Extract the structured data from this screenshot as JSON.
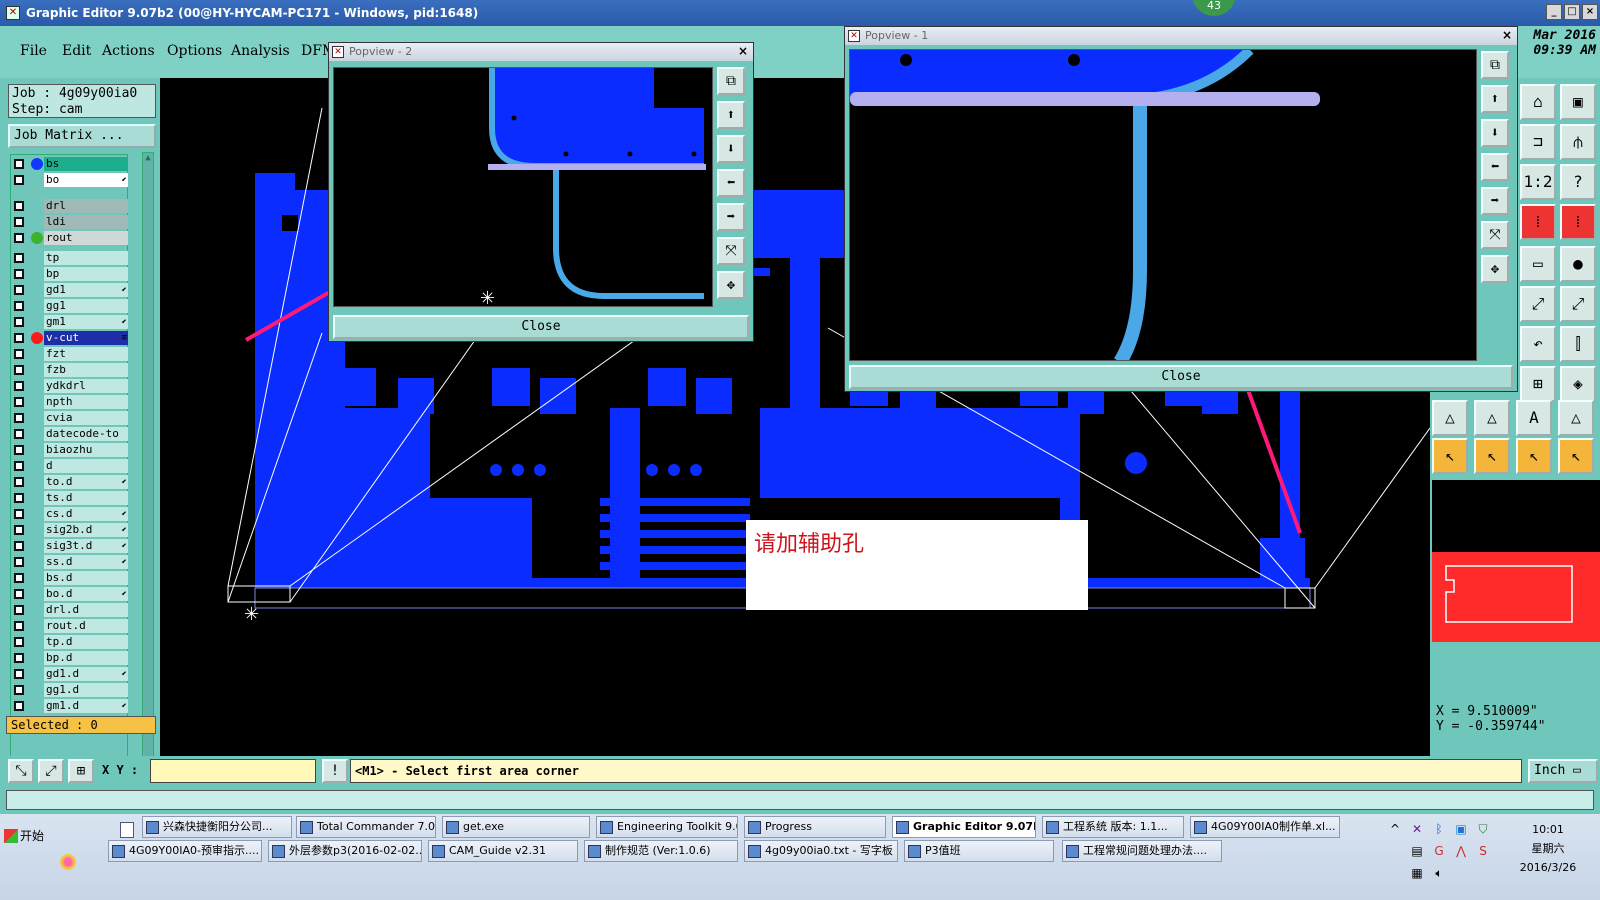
{
  "window": {
    "title": "Graphic Editor 9.07b2 (00@HY-HYCAM-PC171 - Windows, pid:1648)",
    "controls": [
      "_",
      "□",
      "×"
    ],
    "badge": "43"
  },
  "menu": {
    "items": [
      "File",
      "Edit",
      "Actions",
      "Options",
      "Analysis",
      "DFM"
    ],
    "date_line1": "Mar 2016",
    "date_line2": "09:39 AM"
  },
  "left_panel": {
    "job": "Job : 4g09y00ia0",
    "step": "Step: cam",
    "job_matrix": "Job Matrix ...",
    "selected": "Selected : 0",
    "layers": [
      {
        "name": "bs",
        "dot": "#1038ff",
        "highlight": "#1fae8b"
      },
      {
        "name": "bo",
        "dot": "",
        "highlight": "#ffffff",
        "mark": "⬋"
      },
      {
        "name": "drl",
        "dot": "",
        "highlight": "#9fb9b6"
      },
      {
        "name": "ldi",
        "dot": "",
        "highlight": "#9fb9b6"
      },
      {
        "name": "rout",
        "dot": "#3cb32c",
        "highlight": "#cfd9d6"
      },
      {
        "name": "tp",
        "dot": ""
      },
      {
        "name": "bp",
        "dot": ""
      },
      {
        "name": "gd1",
        "dot": "",
        "mark": "⬋"
      },
      {
        "name": "gg1",
        "dot": ""
      },
      {
        "name": "gm1",
        "dot": "",
        "mark": "⬋"
      },
      {
        "name": "v-cut",
        "dot": "#ff1a1a",
        "highlight": "#1e2ea8",
        "textcolor": "#ffffff",
        "mark": "≡"
      },
      {
        "name": "fzt",
        "dot": ""
      },
      {
        "name": "fzb",
        "dot": ""
      },
      {
        "name": "ydkdrl",
        "dot": ""
      },
      {
        "name": "npth",
        "dot": ""
      },
      {
        "name": "cvia",
        "dot": ""
      },
      {
        "name": "datecode-to",
        "dot": ""
      },
      {
        "name": "biaozhu",
        "dot": ""
      },
      {
        "name": "d",
        "dot": ""
      },
      {
        "name": "to.d",
        "dot": "",
        "mark": "⬋"
      },
      {
        "name": "ts.d",
        "dot": ""
      },
      {
        "name": "cs.d",
        "dot": "",
        "mark": "⬋"
      },
      {
        "name": "sig2b.d",
        "dot": "",
        "mark": "⬋"
      },
      {
        "name": "sig3t.d",
        "dot": "",
        "mark": "⬋"
      },
      {
        "name": "ss.d",
        "dot": "",
        "mark": "⬋"
      },
      {
        "name": "bs.d",
        "dot": ""
      },
      {
        "name": "bo.d",
        "dot": "",
        "mark": "⬋"
      },
      {
        "name": "drl.d",
        "dot": ""
      },
      {
        "name": "rout.d",
        "dot": ""
      },
      {
        "name": "tp.d",
        "dot": ""
      },
      {
        "name": "bp.d",
        "dot": ""
      },
      {
        "name": "gd1.d",
        "dot": "",
        "mark": "⬋"
      },
      {
        "name": "gg1.d",
        "dot": ""
      },
      {
        "name": "gm1.d",
        "dot": "",
        "mark": "⬋"
      }
    ]
  },
  "popview2": {
    "title": "Popview - 2",
    "close_label": "Close",
    "close_x": "×"
  },
  "popview1": {
    "title": "Popview - 1",
    "close_label": "Close",
    "close_x": "×"
  },
  "annotation": {
    "text": "请加辅助孔"
  },
  "coords": {
    "x": "X = 9.510009\"",
    "y": "Y = -0.359744\""
  },
  "command": {
    "xy_label": "X Y :",
    "xy_value": "",
    "message": "<M1> - Select first area corner",
    "unit": "Inch ▭"
  },
  "taskbar": {
    "start": "开始",
    "row1": [
      {
        "label": "兴森快捷衡阳分公司..."
      },
      {
        "label": "Total Commander 7.0 ..."
      },
      {
        "label": "get.exe"
      },
      {
        "label": "Engineering Toolkit 9.0..."
      },
      {
        "label": "Progress"
      },
      {
        "label": "Graphic Editor 9.07b...",
        "active": true
      },
      {
        "label": "工程系统  版本: 1.1..."
      },
      {
        "label": "4G09Y00IA0制作单.xl..."
      }
    ],
    "row2": [
      {
        "label": "4G09Y00IA0-预审指示...."
      },
      {
        "label": "外层参数p3(2016-02-02..."
      },
      {
        "label": "CAM_Guide v2.31"
      },
      {
        "label": "制作规范 (Ver:1.0.6)"
      },
      {
        "label": "4g09y00ia0.txt - 写字板"
      },
      {
        "label": "P3值班"
      },
      {
        "label": "工程常规问题处理办法...."
      }
    ],
    "clock_time": "10:01",
    "clock_day": "星期六",
    "clock_date": "2016/3/26"
  },
  "colors": {
    "pcb_blue": "#0a2cff",
    "trace_light": "#4aa8e8",
    "slot": "#b4b0f0",
    "arrow": "#ff1a7a",
    "panel": "#6fc7bb"
  }
}
